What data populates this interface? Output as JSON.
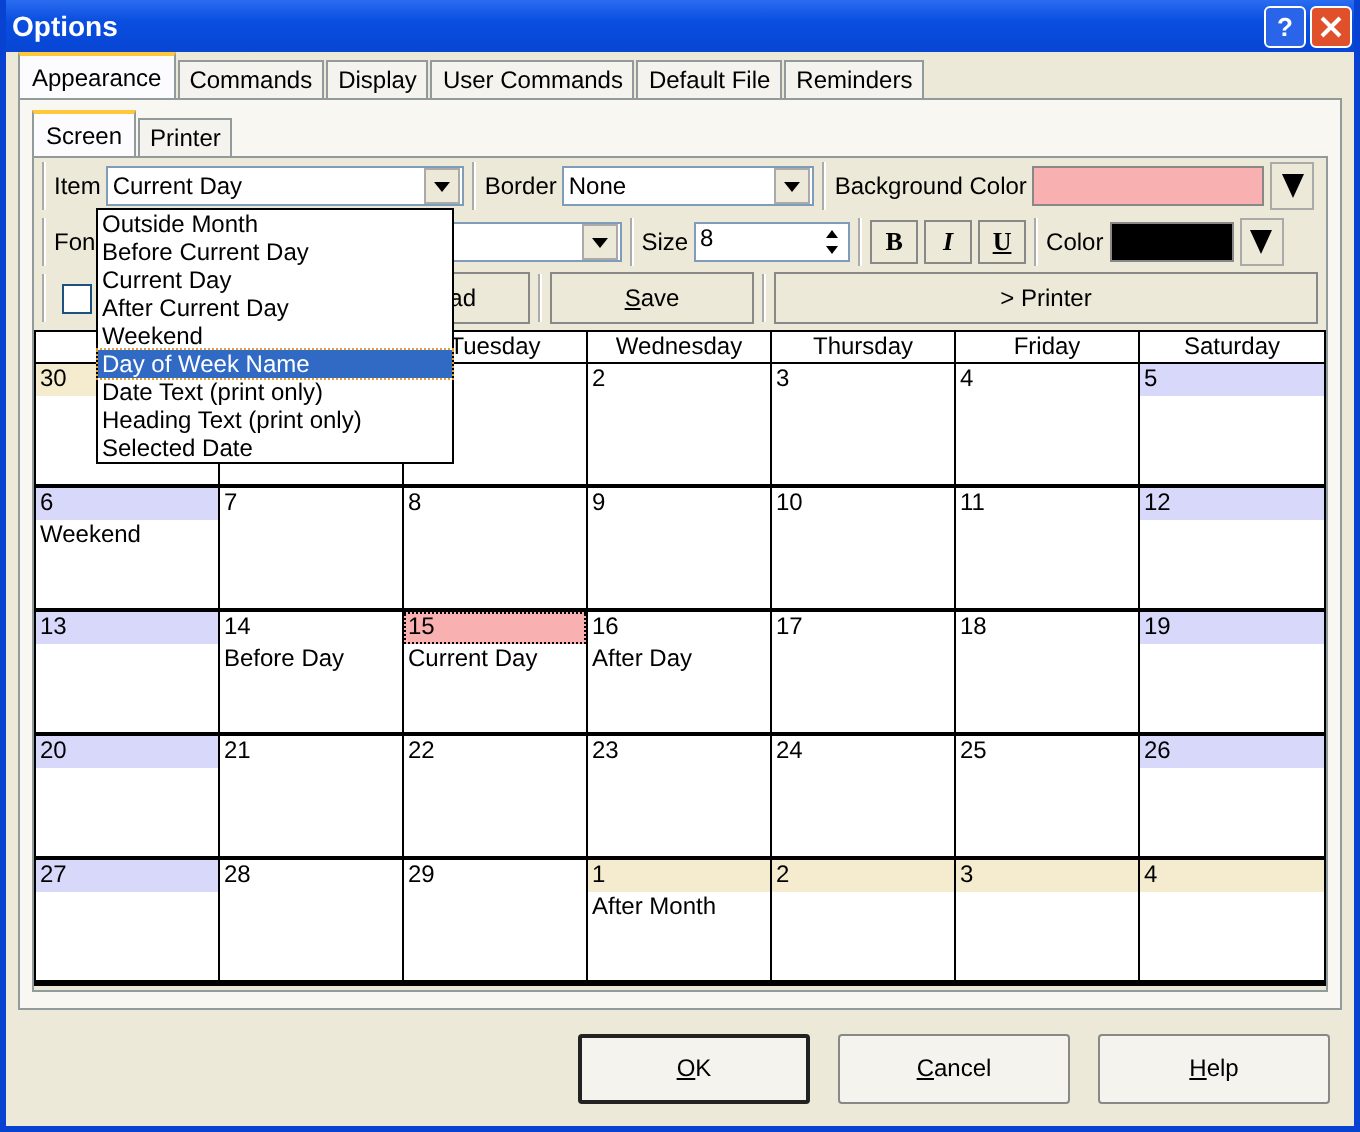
{
  "window": {
    "title": "Options",
    "help_button": "?"
  },
  "tabs": [
    {
      "label": "Appearance",
      "selected": true
    },
    {
      "label": "Commands",
      "selected": false
    },
    {
      "label": "Display",
      "selected": false
    },
    {
      "label": "User Commands",
      "selected": false
    },
    {
      "label": "Default File",
      "selected": false
    },
    {
      "label": "Reminders",
      "selected": false
    }
  ],
  "subtabs": [
    {
      "label": "Screen",
      "selected": true
    },
    {
      "label": "Printer",
      "selected": false
    }
  ],
  "toolbar": {
    "item_label": "Item",
    "item_value": "Current Day",
    "border_label": "Border",
    "border_value": "None",
    "background_label": "Background Color",
    "font_label": "Fon",
    "size_label": "Size",
    "size_value": "8",
    "styles": [
      "B",
      "I",
      "U"
    ],
    "color_label": "Color",
    "checkbox_checked": false,
    "load_button": "ad",
    "save_button": "Save",
    "printer_button": "> Printer"
  },
  "dropdown": [
    {
      "label": "Outside Month",
      "selected": false
    },
    {
      "label": "Before Current Day",
      "selected": false
    },
    {
      "label": "Current Day",
      "selected": false
    },
    {
      "label": "After Current Day",
      "selected": false
    },
    {
      "label": "Weekend",
      "selected": false
    },
    {
      "label": "Day of Week Name",
      "selected": true
    },
    {
      "label": "Date Text (print only)",
      "selected": false
    },
    {
      "label": "Heading Text (print only)",
      "selected": false
    },
    {
      "label": "Selected Date",
      "selected": false
    }
  ],
  "calendar": {
    "headers": [
      "Tuesday",
      "Wednesday",
      "Thursday",
      "Friday",
      "Saturday"
    ],
    "weeks": [
      [
        {
          "date": "30",
          "kind": "outside",
          "selected": false
        },
        {
          "date": "2",
          "kind": "normal",
          "selected": false
        },
        {
          "date": "3",
          "kind": "normal",
          "selected": false
        },
        {
          "date": "4",
          "kind": "normal",
          "selected": false
        },
        {
          "date": "5",
          "kind": "weekend",
          "selected": false
        }
      ],
      [
        {
          "date": "6",
          "kind": "weekend",
          "note": "Weekend",
          "selected": false
        },
        {
          "date": "7",
          "kind": "normal",
          "selected": false
        },
        {
          "date": "8",
          "kind": "normal",
          "selected": false
        },
        {
          "date": "9",
          "kind": "normal",
          "selected": false
        },
        {
          "date": "10",
          "kind": "normal",
          "selected": false
        },
        {
          "date": "11",
          "kind": "normal",
          "selected": false
        },
        {
          "date": "12",
          "kind": "weekend",
          "selected": false
        }
      ],
      [
        {
          "date": "13",
          "kind": "weekend",
          "selected": false
        },
        {
          "date": "14",
          "kind": "normal",
          "note": "Before Day",
          "selected": false
        },
        {
          "date": "15",
          "kind": "current",
          "note": "Current Day",
          "selected": true
        },
        {
          "date": "16",
          "kind": "normal",
          "note": "After Day",
          "selected": false
        },
        {
          "date": "17",
          "kind": "normal",
          "selected": false
        },
        {
          "date": "18",
          "kind": "normal",
          "selected": false
        },
        {
          "date": "19",
          "kind": "weekend",
          "selected": false
        }
      ],
      [
        {
          "date": "20",
          "kind": "weekend",
          "selected": false
        },
        {
          "date": "21",
          "kind": "normal",
          "selected": false
        },
        {
          "date": "22",
          "kind": "normal",
          "selected": false
        },
        {
          "date": "23",
          "kind": "normal",
          "selected": false
        },
        {
          "date": "24",
          "kind": "normal",
          "selected": false
        },
        {
          "date": "25",
          "kind": "normal",
          "selected": false
        },
        {
          "date": "26",
          "kind": "weekend",
          "selected": false
        }
      ],
      [
        {
          "date": "27",
          "kind": "weekend",
          "selected": false
        },
        {
          "date": "28",
          "kind": "normal",
          "selected": false
        },
        {
          "date": "29",
          "kind": "normal",
          "selected": false
        },
        {
          "date": "1",
          "kind": "outside",
          "note": "After Month",
          "selected": false
        },
        {
          "date": "2",
          "kind": "outside",
          "selected": false
        },
        {
          "date": "3",
          "kind": "outside",
          "selected": false
        },
        {
          "date": "4",
          "kind": "outside",
          "selected": false
        }
      ]
    ]
  },
  "buttons": [
    {
      "label": "OK",
      "default": true
    },
    {
      "label": "Cancel",
      "default": false
    },
    {
      "label": "Help",
      "default": false
    }
  ]
}
